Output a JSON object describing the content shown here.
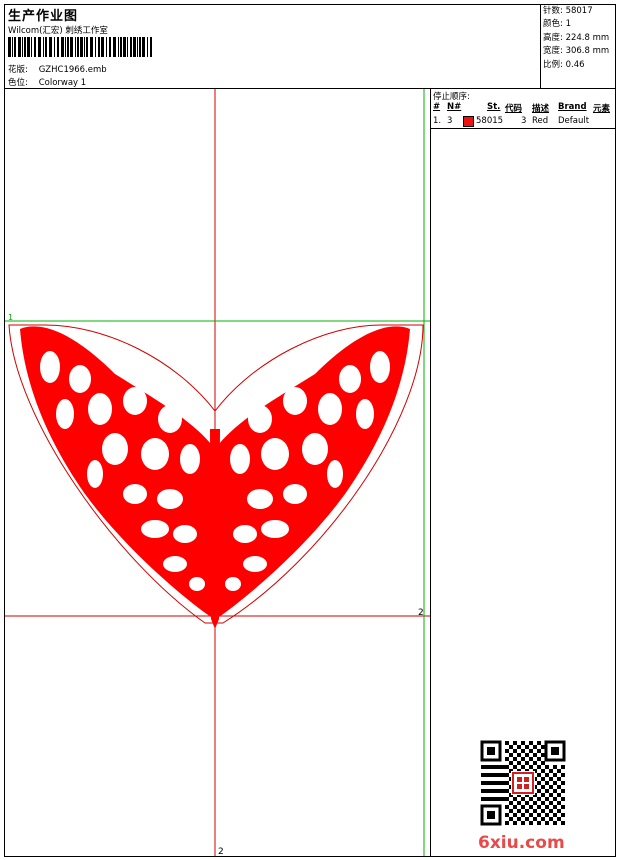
{
  "header": {
    "title": "生产作业图",
    "company": "Wilcom(汇宏) 刺绣工作室",
    "design_label": "花版:",
    "design_value": "GZHC1966.emb",
    "color_label": "色位:",
    "color_value": "Colorway 1"
  },
  "stats": [
    {
      "label": "针数:",
      "value": "58017"
    },
    {
      "label": "颜色:",
      "value": "1"
    },
    {
      "label": "高度:",
      "value": "224.8 mm"
    },
    {
      "label": "宽度:",
      "value": "306.8 mm"
    },
    {
      "label": "比例:",
      "value": "0.46"
    }
  ],
  "stop_sequence": {
    "title": "停止顺序:",
    "headers": [
      "#",
      "N#",
      "St.",
      "代码",
      "描述",
      "Brand",
      "元素"
    ],
    "rows": [
      {
        "num": "1.",
        "needle": "3",
        "stitches": "58015",
        "code": "3",
        "description": "Red",
        "brand": "Default",
        "swatch": "#ee1111"
      }
    ]
  },
  "canvas": {
    "marker_top_left": "1",
    "marker_right": "2",
    "marker_bottom": "2",
    "fill_color": "#ff0000",
    "guide_red": "#d00000",
    "guide_green": "#00b000"
  },
  "watermark": {
    "site": "6xiu.com"
  }
}
